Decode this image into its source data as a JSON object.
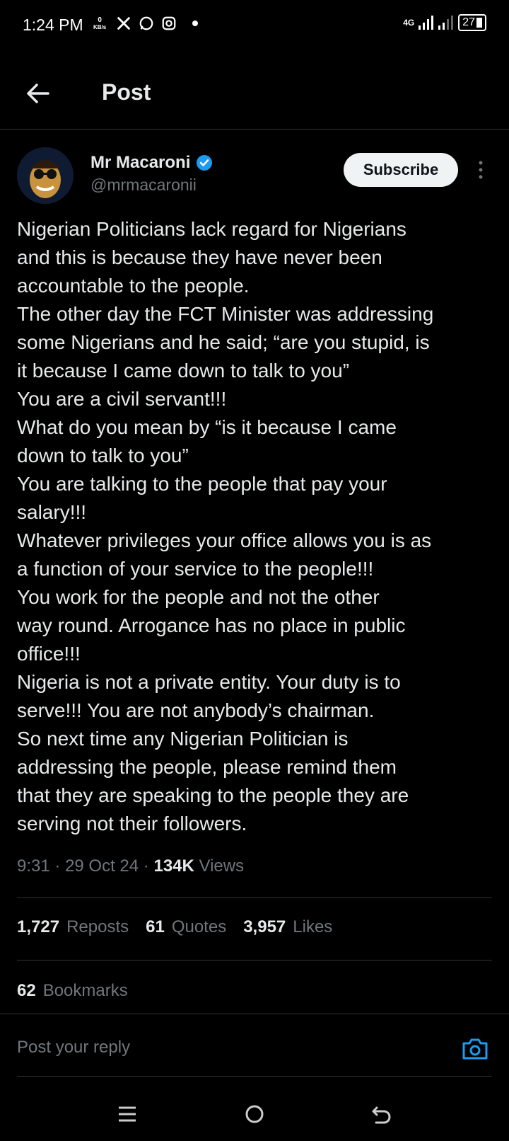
{
  "status_bar": {
    "time": "1:24 PM",
    "kbs_value": "0",
    "kbs_unit": "KB/s",
    "network": "4G",
    "battery": "27"
  },
  "header": {
    "title": "Post"
  },
  "post": {
    "author_name": "Mr Macaroni",
    "author_handle": "@mrmacaronii",
    "subscribe_label": "Subscribe",
    "text": "Nigerian Politicians lack regard for Nigerians\nand this is because they have never been\naccountable to the people.\nThe other day the FCT Minister was addressing\nsome Nigerians and he said; “are you stupid, is\nit because I came down to talk to you”\nYou are a civil servant!!!\nWhat do you mean by “is it because I came\ndown to talk to you”\nYou are talking to the people that pay your\nsalary!!!\nWhatever privileges your office allows you is as\na function of your service to the people!!!\nYou work for the people and not the other\nway round. Arrogance has no place in public\noffice!!!\nNigeria is not a private entity. Your duty is to\nserve!!! You are not anybody’s chairman.\nSo next time any Nigerian Politician is\naddressing the people, please remind them\nthat they are speaking to the people they are\nserving not their followers.",
    "time": "9:31",
    "date": "29 Oct 24",
    "views_count": "134K",
    "views_label": "Views"
  },
  "stats": {
    "reposts_count": "1,727",
    "reposts_label": "Reposts",
    "quotes_count": "61",
    "quotes_label": "Quotes",
    "likes_count": "3,957",
    "likes_label": "Likes",
    "bookmarks_count": "62",
    "bookmarks_label": "Bookmarks"
  },
  "reply": {
    "placeholder": "Post your reply"
  },
  "colors": {
    "background": "#000000",
    "text": "#e7e9ea",
    "secondary": "#71767b",
    "accent": "#1d9bf0"
  }
}
